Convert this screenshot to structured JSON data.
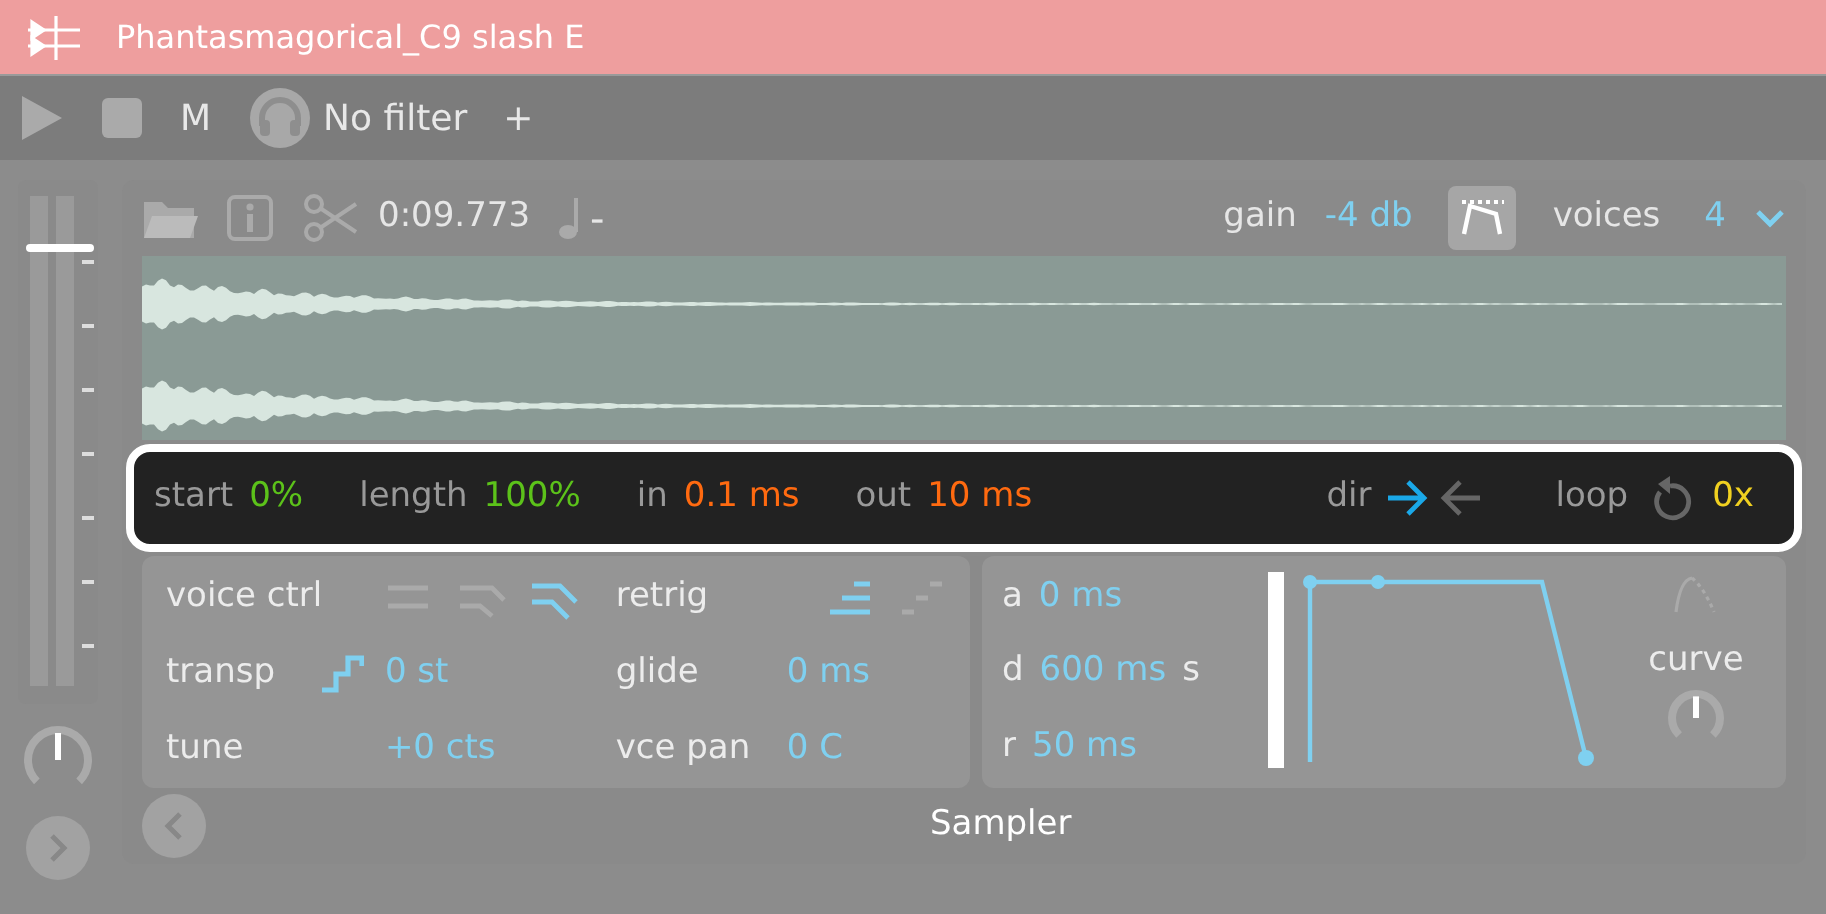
{
  "title": "Phantasmagorical_C9 slash E",
  "toolbar": {
    "mute": "M",
    "filter": "No filter",
    "add": "+"
  },
  "side": {
    "fader": {
      "level": 0.9
    }
  },
  "header": {
    "time": "0:09.773",
    "note": "-",
    "gain_label": "gain",
    "gain": "-4 db",
    "voices_label": "voices",
    "voices": "4"
  },
  "region": {
    "items": [
      {
        "label": "start",
        "value": "0%",
        "color": "#5cc21a"
      },
      {
        "label": "length",
        "value": "100%",
        "color": "#5cc21a"
      },
      {
        "label": "in",
        "value": "0.1 ms",
        "color": "#ff6a10"
      },
      {
        "label": "out",
        "value": "10 ms",
        "color": "#ff6a10"
      }
    ],
    "dir_label": "dir",
    "directions": [
      {
        "selected": true
      },
      {
        "selected": false
      }
    ],
    "loop_label": "loop",
    "loop": "0x"
  },
  "voice": {
    "ctrl_label": "voice ctrl",
    "ctrl_modes": [
      {
        "selected": false
      },
      {
        "selected": false
      },
      {
        "selected": true
      }
    ],
    "retrig_label": "retrig",
    "retrig_modes": [
      {
        "selected": true
      },
      {
        "selected": false
      }
    ],
    "transp_label": "transp",
    "transp": "0 st",
    "glide_label": "glide",
    "glide": "0 ms",
    "tune_label": "tune",
    "tune": "+0 cts",
    "pan_label": "vce pan",
    "pan": "0 C"
  },
  "envelope": {
    "rows": [
      {
        "label": "a",
        "value": "0 ms"
      },
      {
        "label": "d",
        "value": "600 ms",
        "suffix": "s"
      },
      {
        "label": "r",
        "value": "50 ms"
      }
    ],
    "sustain": {
      "level": 1
    },
    "curve_label": "curve"
  },
  "footer": "Sampler"
}
